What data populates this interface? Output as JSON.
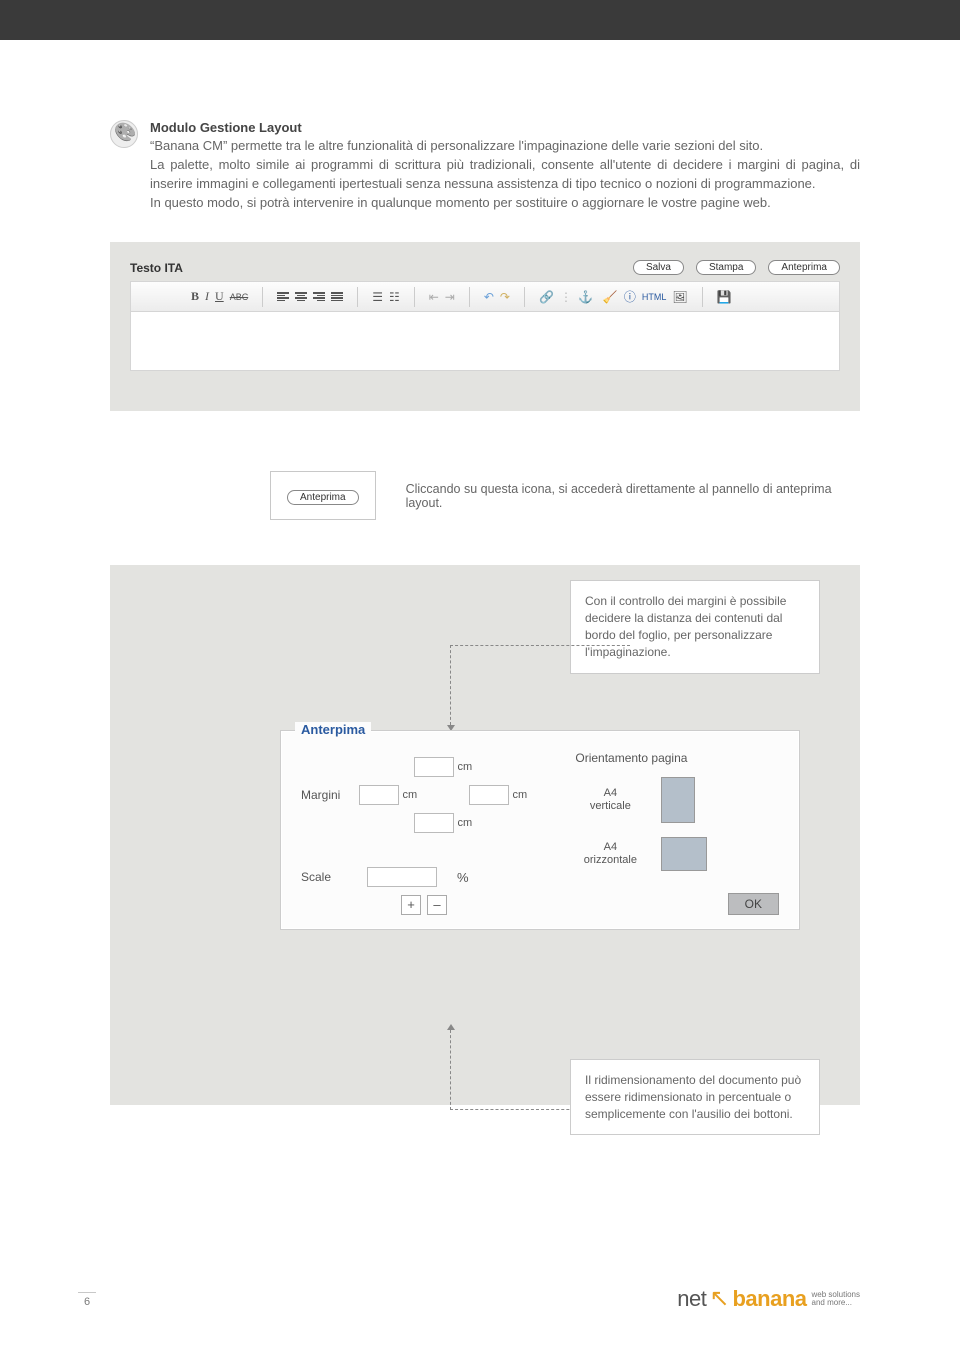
{
  "header": {
    "title": "Modulo Gestione Layout",
    "p1": "“Banana CM” permette tra le altre funzionalità di personalizzare l'impaginazione delle varie sezioni del sito.",
    "p2": "La palette, molto simile ai programmi di scrittura più tradizionali, consente all'utente di decidere i margini di pagina, di inserire immagini e collegamenti ipertestuali senza nessuna assistenza di tipo tecnico o nozioni di programmazione.",
    "p3": "In questo modo, si potrà intervenire in qualunque momento per sostituire o aggiornare le vostre pagine web."
  },
  "editor": {
    "title": "Testo ITA",
    "buttons": {
      "salva": "Salva",
      "stampa": "Stampa",
      "anteprima": "Anteprima"
    },
    "tb": {
      "abc": "ABC",
      "html": "HTML"
    }
  },
  "anteprima_tip": {
    "button": "Anteprima",
    "text": "Cliccando su questa icona, si accederà direttamente al pannello di anteprima layout."
  },
  "callouts": {
    "margins": "Con il controllo dei margini è possibile decidere la distanza dei contenuti dal bordo del foglio, per personalizzare l'impaginazione.",
    "scale": "Il ridimensionamento del documento può essere ridimensionato in percentuale o semplicemente con l'ausilio dei bottoni."
  },
  "panel": {
    "legend": "Anterpima",
    "margini_label": "Margini",
    "cm": "cm",
    "scale_label": "Scale",
    "percent": "%",
    "plus": "+",
    "minus": "–",
    "orient_title": "Orientamento pagina",
    "a4v": "A4\nverticale",
    "a4o": "A4\norizzontale",
    "ok": "OK"
  },
  "footer": {
    "page": "6",
    "logo_net": "net",
    "logo_banana": "banana",
    "logo_tag1": "web solutions",
    "logo_tag2": "and more..."
  }
}
